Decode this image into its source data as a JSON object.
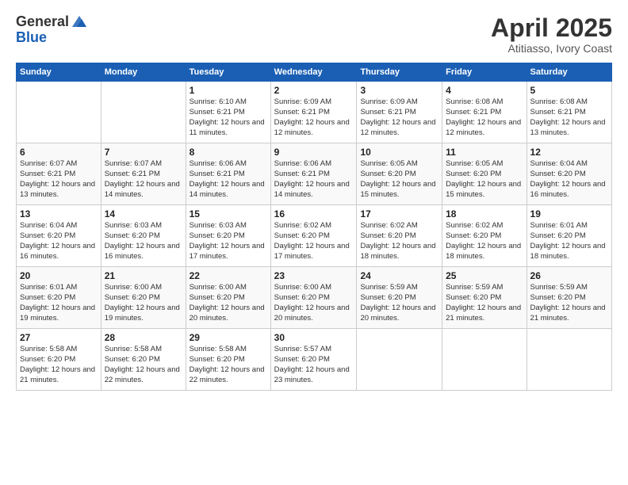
{
  "logo": {
    "general": "General",
    "blue": "Blue"
  },
  "title": "April 2025",
  "subtitle": "Atitiasso, Ivory Coast",
  "days_of_week": [
    "Sunday",
    "Monday",
    "Tuesday",
    "Wednesday",
    "Thursday",
    "Friday",
    "Saturday"
  ],
  "weeks": [
    [
      {
        "day": "",
        "info": ""
      },
      {
        "day": "",
        "info": ""
      },
      {
        "day": "1",
        "info": "Sunrise: 6:10 AM\nSunset: 6:21 PM\nDaylight: 12 hours and 11 minutes."
      },
      {
        "day": "2",
        "info": "Sunrise: 6:09 AM\nSunset: 6:21 PM\nDaylight: 12 hours and 12 minutes."
      },
      {
        "day": "3",
        "info": "Sunrise: 6:09 AM\nSunset: 6:21 PM\nDaylight: 12 hours and 12 minutes."
      },
      {
        "day": "4",
        "info": "Sunrise: 6:08 AM\nSunset: 6:21 PM\nDaylight: 12 hours and 12 minutes."
      },
      {
        "day": "5",
        "info": "Sunrise: 6:08 AM\nSunset: 6:21 PM\nDaylight: 12 hours and 13 minutes."
      }
    ],
    [
      {
        "day": "6",
        "info": "Sunrise: 6:07 AM\nSunset: 6:21 PM\nDaylight: 12 hours and 13 minutes."
      },
      {
        "day": "7",
        "info": "Sunrise: 6:07 AM\nSunset: 6:21 PM\nDaylight: 12 hours and 14 minutes."
      },
      {
        "day": "8",
        "info": "Sunrise: 6:06 AM\nSunset: 6:21 PM\nDaylight: 12 hours and 14 minutes."
      },
      {
        "day": "9",
        "info": "Sunrise: 6:06 AM\nSunset: 6:21 PM\nDaylight: 12 hours and 14 minutes."
      },
      {
        "day": "10",
        "info": "Sunrise: 6:05 AM\nSunset: 6:20 PM\nDaylight: 12 hours and 15 minutes."
      },
      {
        "day": "11",
        "info": "Sunrise: 6:05 AM\nSunset: 6:20 PM\nDaylight: 12 hours and 15 minutes."
      },
      {
        "day": "12",
        "info": "Sunrise: 6:04 AM\nSunset: 6:20 PM\nDaylight: 12 hours and 16 minutes."
      }
    ],
    [
      {
        "day": "13",
        "info": "Sunrise: 6:04 AM\nSunset: 6:20 PM\nDaylight: 12 hours and 16 minutes."
      },
      {
        "day": "14",
        "info": "Sunrise: 6:03 AM\nSunset: 6:20 PM\nDaylight: 12 hours and 16 minutes."
      },
      {
        "day": "15",
        "info": "Sunrise: 6:03 AM\nSunset: 6:20 PM\nDaylight: 12 hours and 17 minutes."
      },
      {
        "day": "16",
        "info": "Sunrise: 6:02 AM\nSunset: 6:20 PM\nDaylight: 12 hours and 17 minutes."
      },
      {
        "day": "17",
        "info": "Sunrise: 6:02 AM\nSunset: 6:20 PM\nDaylight: 12 hours and 18 minutes."
      },
      {
        "day": "18",
        "info": "Sunrise: 6:02 AM\nSunset: 6:20 PM\nDaylight: 12 hours and 18 minutes."
      },
      {
        "day": "19",
        "info": "Sunrise: 6:01 AM\nSunset: 6:20 PM\nDaylight: 12 hours and 18 minutes."
      }
    ],
    [
      {
        "day": "20",
        "info": "Sunrise: 6:01 AM\nSunset: 6:20 PM\nDaylight: 12 hours and 19 minutes."
      },
      {
        "day": "21",
        "info": "Sunrise: 6:00 AM\nSunset: 6:20 PM\nDaylight: 12 hours and 19 minutes."
      },
      {
        "day": "22",
        "info": "Sunrise: 6:00 AM\nSunset: 6:20 PM\nDaylight: 12 hours and 20 minutes."
      },
      {
        "day": "23",
        "info": "Sunrise: 6:00 AM\nSunset: 6:20 PM\nDaylight: 12 hours and 20 minutes."
      },
      {
        "day": "24",
        "info": "Sunrise: 5:59 AM\nSunset: 6:20 PM\nDaylight: 12 hours and 20 minutes."
      },
      {
        "day": "25",
        "info": "Sunrise: 5:59 AM\nSunset: 6:20 PM\nDaylight: 12 hours and 21 minutes."
      },
      {
        "day": "26",
        "info": "Sunrise: 5:59 AM\nSunset: 6:20 PM\nDaylight: 12 hours and 21 minutes."
      }
    ],
    [
      {
        "day": "27",
        "info": "Sunrise: 5:58 AM\nSunset: 6:20 PM\nDaylight: 12 hours and 21 minutes."
      },
      {
        "day": "28",
        "info": "Sunrise: 5:58 AM\nSunset: 6:20 PM\nDaylight: 12 hours and 22 minutes."
      },
      {
        "day": "29",
        "info": "Sunrise: 5:58 AM\nSunset: 6:20 PM\nDaylight: 12 hours and 22 minutes."
      },
      {
        "day": "30",
        "info": "Sunrise: 5:57 AM\nSunset: 6:20 PM\nDaylight: 12 hours and 23 minutes."
      },
      {
        "day": "",
        "info": ""
      },
      {
        "day": "",
        "info": ""
      },
      {
        "day": "",
        "info": ""
      }
    ]
  ]
}
